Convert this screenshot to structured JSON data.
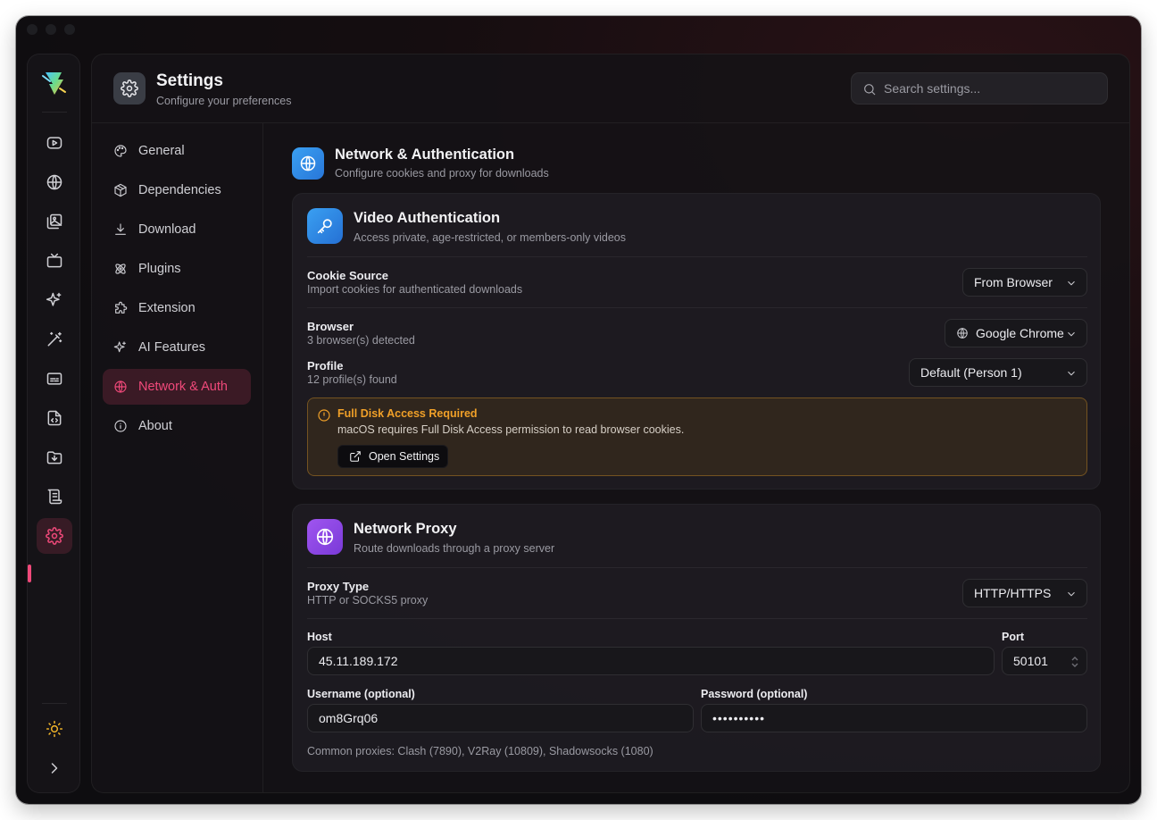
{
  "app": {
    "title": "Settings",
    "subtitle": "Configure your preferences",
    "search_placeholder": "Search settings..."
  },
  "rail": {
    "items": [
      {
        "icon": "video-icon"
      },
      {
        "icon": "globe-icon"
      },
      {
        "icon": "images-icon"
      },
      {
        "icon": "tv-icon"
      },
      {
        "icon": "sparkles-icon"
      },
      {
        "icon": "magic-wand-icon"
      },
      {
        "icon": "subtitles-icon"
      },
      {
        "icon": "file-code-icon"
      },
      {
        "icon": "folder-download-icon"
      },
      {
        "icon": "scroll-icon"
      },
      {
        "icon": "gear-icon",
        "active": true
      }
    ],
    "bottom": [
      {
        "icon": "sun-icon"
      },
      {
        "icon": "chevron-right-icon"
      }
    ],
    "accent": "#f0497a"
  },
  "nav": {
    "items": [
      {
        "label": "General",
        "icon": "palette-icon"
      },
      {
        "label": "Dependencies",
        "icon": "package-icon"
      },
      {
        "label": "Download",
        "icon": "download-icon"
      },
      {
        "label": "Plugins",
        "icon": "atom-icon"
      },
      {
        "label": "Extension",
        "icon": "puzzle-icon"
      },
      {
        "label": "AI Features",
        "icon": "sparkles-icon"
      },
      {
        "label": "Network & Auth",
        "icon": "globe-icon",
        "active": true
      },
      {
        "label": "About",
        "icon": "info-icon"
      }
    ]
  },
  "section": {
    "title": "Network & Authentication",
    "subtitle": "Configure cookies and proxy for downloads"
  },
  "video_auth": {
    "title": "Video Authentication",
    "subtitle": "Access private, age-restricted, or members-only videos",
    "cookie_source": {
      "label": "Cookie Source",
      "desc": "Import cookies for authenticated downloads",
      "value": "From Browser"
    },
    "browser": {
      "label": "Browser",
      "desc": "3 browser(s) detected",
      "value": "Google Chrome"
    },
    "profile": {
      "label": "Profile",
      "desc": "12 profile(s) found",
      "value": "Default (Person 1)"
    },
    "warning": {
      "title": "Full Disk Access Required",
      "text": "macOS requires Full Disk Access permission to read browser cookies.",
      "button": "Open Settings",
      "color": "#f0a028"
    }
  },
  "proxy": {
    "title": "Network Proxy",
    "subtitle": "Route downloads through a proxy server",
    "type": {
      "label": "Proxy Type",
      "desc": "HTTP or SOCKS5 proxy",
      "value": "HTTP/HTTPS"
    },
    "host": {
      "label": "Host",
      "value": "45.11.189.172"
    },
    "port": {
      "label": "Port",
      "value": "50101"
    },
    "username": {
      "label": "Username (optional)",
      "value": "om8Grq06"
    },
    "password": {
      "label": "Password (optional)",
      "value": "••••••••••"
    },
    "hint": "Common proxies: Clash (7890), V2Ray (10809), Shadowsocks (1080)"
  }
}
